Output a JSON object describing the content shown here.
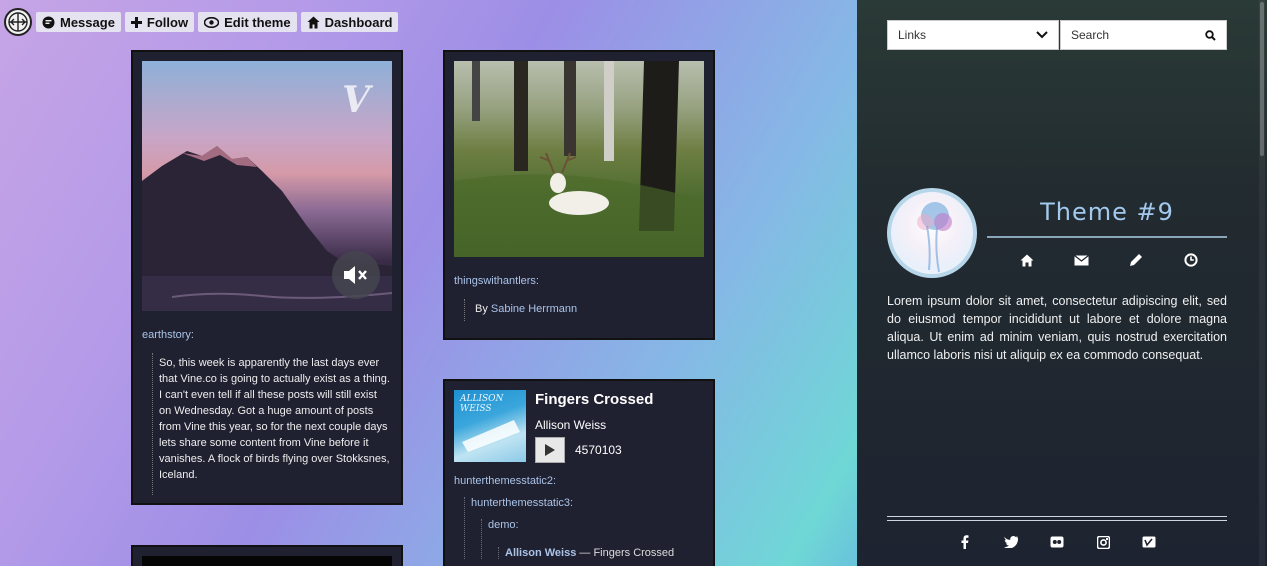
{
  "topbar": {
    "message_label": "Message",
    "follow_label": "Follow",
    "edit_label": "Edit theme",
    "dashboard_label": "Dashboard"
  },
  "posts": {
    "vine": {
      "logo": "V",
      "source": "earthstory:",
      "caption": "So, this week is apparently the last days ever that Vine.co is going to actually exist as a thing. I can't even tell if all these posts will still exist on Wednesday. Got a huge amount of posts from Vine this year, so for the next couple days lets share some content from Vine before it vanishes. A flock of birds flying over Stokksnes, Iceland."
    },
    "deer": {
      "source": "thingswithantlers:",
      "by_prefix": "By",
      "author": "Sabine Herrmann"
    },
    "audio": {
      "album_text": "ALLISON WEISS",
      "title": "Fingers Crossed",
      "artist": "Allison Weiss",
      "plays": "4570103",
      "reblog1": "hunterthemesstatic2:",
      "reblog2": "hunterthemesstatic3:",
      "reblog3": "demo:",
      "track_artist": "Allison Weiss",
      "track_sep": " — ",
      "track_title": "Fingers Crossed"
    }
  },
  "sidebar": {
    "links_label": "Links",
    "search_placeholder": "Search",
    "title": "Theme #9",
    "about": "Lorem ipsum dolor sit amet, consectetur adipiscing elit, sed do eiusmod tempor incididunt ut labore et dolore magna aliqua. Ut enim ad minim veniam, quis nostrud exercitation ullamco laboris nisi ut aliquip ex ea commodo consequat.",
    "nav_icons": [
      "home-icon",
      "mail-icon",
      "pencil-icon",
      "clock-icon"
    ],
    "social_icons": [
      "facebook-icon",
      "twitter-icon",
      "flickr-icon",
      "instagram-icon",
      "vimeo-icon"
    ]
  },
  "colors": {
    "post_bg": "#1f2030",
    "link": "#aac4e8",
    "title_accent": "#a3c9ee",
    "sidebar_bg": "#1d2330"
  }
}
